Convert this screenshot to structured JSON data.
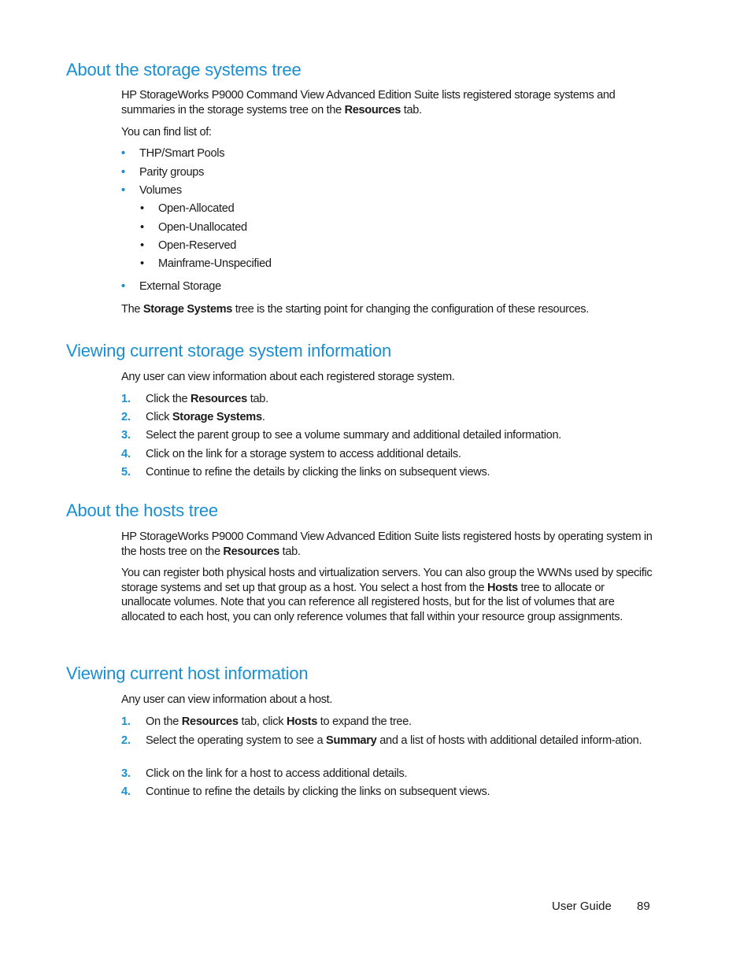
{
  "sections": [
    {
      "heading": "About the storage systems tree",
      "intro": {
        "pre": "HP StorageWorks P9000 Command View Advanced Edition Suite lists registered storage systems and summaries in the storage systems tree on the ",
        "bold": "Resources",
        "post": " tab."
      },
      "list_intro": "You can find list of:",
      "items": [
        "THP/Smart Pools",
        "Parity groups",
        "Volumes",
        "External Storage"
      ],
      "volume_subitems": [
        "Open-Allocated",
        "Open-Unallocated",
        "Open-Reserved",
        "Mainframe-Unspecified"
      ],
      "closing": {
        "pre": "The ",
        "bold": "Storage Systems",
        "post": " tree is the starting point for changing the configuration of these resources."
      }
    },
    {
      "heading": "Viewing current storage system information",
      "intro": "Any user can view information about each registered storage system.",
      "steps": [
        {
          "num": "1.",
          "pre": "Click the ",
          "bold": "Resources",
          "post": " tab."
        },
        {
          "num": "2.",
          "pre": "Click ",
          "bold": "Storage Systems",
          "post": "."
        },
        {
          "num": "3.",
          "pre": "Select the parent group to see a volume summary and additional detailed information.",
          "bold": "",
          "post": ""
        },
        {
          "num": "4.",
          "pre": "Click on the link for a storage system to access additional details.",
          "bold": "",
          "post": ""
        },
        {
          "num": "5.",
          "pre": "Continue to refine the details by clicking the links on subsequent views.",
          "bold": "",
          "post": ""
        }
      ]
    },
    {
      "heading": "About the hosts tree",
      "intro": {
        "pre": "HP StorageWorks P9000 Command View Advanced Edition Suite lists registered hosts by operating system in the hosts tree on the ",
        "bold": "Resources",
        "post": " tab."
      },
      "body": {
        "pre": "You can register both physical hosts and virtualization servers. You can also group the WWNs used by specific storage systems and set up that group as a host. You select a host from the ",
        "bold": "Hosts",
        "post": " tree to allocate or unallocate volumes. Note that you can reference all registered hosts, but for the list of volumes that are allocated to each host, you can only reference volumes that fall within your resource group assignments."
      }
    },
    {
      "heading": "Viewing current host information",
      "intro": "Any user can view information about a host.",
      "steps": [
        {
          "num": "1.",
          "pre": "On the ",
          "bold": "Resources",
          "mid": " tab, click ",
          "bold2": "Hosts",
          "post": " to expand the tree."
        },
        {
          "num": "2.",
          "pre": "Select the operating system to see a ",
          "bold": "Summary",
          "post": " and a list of hosts with additional detailed inform-ation."
        },
        {
          "num": "3.",
          "pre": "Click on the link for a host to access additional details.",
          "bold": "",
          "post": ""
        },
        {
          "num": "4.",
          "pre": "Continue to refine the details by clicking the links on subsequent views.",
          "bold": "",
          "post": ""
        }
      ]
    }
  ],
  "footer": {
    "title": "User Guide",
    "page": "89"
  },
  "colors": {
    "accent": "#1a8fd1",
    "text": "#1a1a1a"
  }
}
